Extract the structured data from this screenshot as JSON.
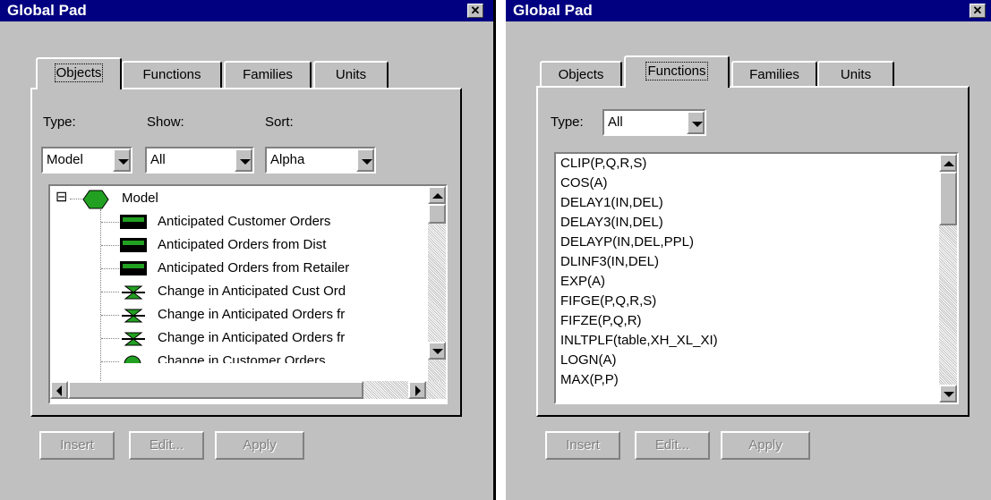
{
  "left_window": {
    "title": "Global Pad",
    "close_glyph": "✕",
    "tabs": [
      {
        "label": "Objects",
        "active": true
      },
      {
        "label": "Functions",
        "active": false
      },
      {
        "label": "Families",
        "active": false
      },
      {
        "label": "Units",
        "active": false
      }
    ],
    "type_label": "Type:",
    "show_label": "Show:",
    "sort_label": "Sort:",
    "type_value": "Model",
    "show_value": "All",
    "sort_value": "Alpha",
    "tree": {
      "root_label": "Model",
      "expander": "⊟",
      "items": [
        {
          "label": "Anticipated Customer Orders",
          "icon": "stock-icon"
        },
        {
          "label": "Anticipated Orders from Dist",
          "icon": "stock-icon"
        },
        {
          "label": "Anticipated Orders from Retailer",
          "icon": "stock-icon"
        },
        {
          "label": "Change in Anticipated Cust Ord",
          "icon": "flow-icon"
        },
        {
          "label": "Change in Anticipated Orders fr",
          "icon": "flow-icon"
        },
        {
          "label": "Change in Anticipated Orders fr",
          "icon": "flow-icon"
        },
        {
          "label": "Change in Customer Orders",
          "icon": "converter-icon"
        }
      ]
    },
    "buttons": {
      "insert": "Insert",
      "edit": "Edit...",
      "apply": "Apply"
    }
  },
  "right_window": {
    "title": "Global Pad",
    "close_glyph": "✕",
    "tabs": [
      {
        "label": "Objects",
        "active": false
      },
      {
        "label": "Functions",
        "active": true
      },
      {
        "label": "Families",
        "active": false
      },
      {
        "label": "Units",
        "active": false
      }
    ],
    "type_label": "Type:",
    "type_value": "All",
    "functions": [
      "CLIP(P,Q,R,S)",
      "COS(A)",
      "DELAY1(IN,DEL)",
      "DELAY3(IN,DEL)",
      "DELAYP(IN,DEL,PPL)",
      "DLINF3(IN,DEL)",
      "EXP(A)",
      "FIFGE(P,Q,R,S)",
      "FIFZE(P,Q,R)",
      "INLTPLF(table,XH_XL_XI)",
      "LOGN(A)",
      "MAX(P,P)"
    ],
    "buttons": {
      "insert": "Insert",
      "edit": "Edit...",
      "apply": "Apply"
    }
  },
  "colors": {
    "titlebar": "#000080",
    "face": "#c0c0c0",
    "icon_green": "#22a022"
  }
}
